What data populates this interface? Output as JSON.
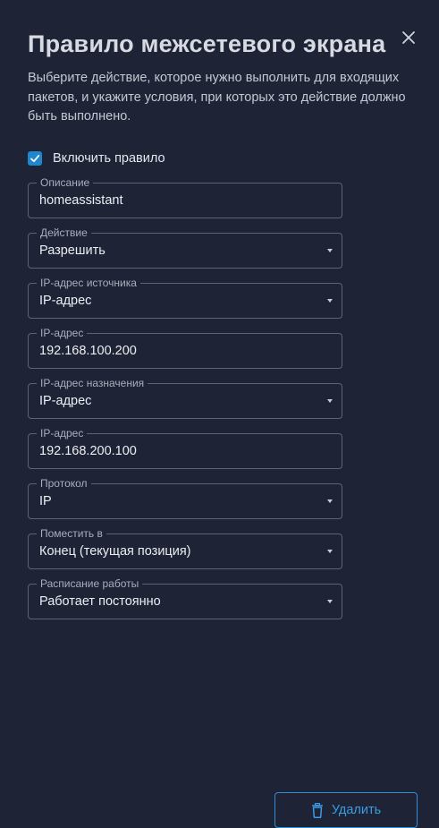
{
  "dialog": {
    "title": "Правило межсетевого экрана",
    "description": "Выберите действие, которое нужно выполнить для входящих пакетов, и укажите условия, при которых это действие должно быть выполнено.",
    "close_icon": "close-icon"
  },
  "enable_rule": {
    "label": "Включить правило",
    "checked": true
  },
  "fields": {
    "description": {
      "label": "Описание",
      "value": "homeassistant"
    },
    "action": {
      "label": "Действие",
      "value": "Разрешить"
    },
    "source_ip_type": {
      "label": "IP-адрес источника",
      "value": "IP-адрес"
    },
    "source_ip": {
      "label": "IP-адрес",
      "value": "192.168.100.200"
    },
    "dest_ip_type": {
      "label": "IP-адрес назначения",
      "value": "IP-адрес"
    },
    "dest_ip": {
      "label": "IP-адрес",
      "value": "192.168.200.100"
    },
    "protocol": {
      "label": "Протокол",
      "value": "IP"
    },
    "position": {
      "label": "Поместить в",
      "value": "Конец (текущая позиция)"
    },
    "schedule": {
      "label": "Расписание работы",
      "value": "Работает постоянно"
    }
  },
  "footer": {
    "delete_label": "Удалить",
    "delete_icon": "trash-icon"
  },
  "colors": {
    "background": "#1e2435",
    "accent": "#1f86d0",
    "border": "#5b6275"
  }
}
